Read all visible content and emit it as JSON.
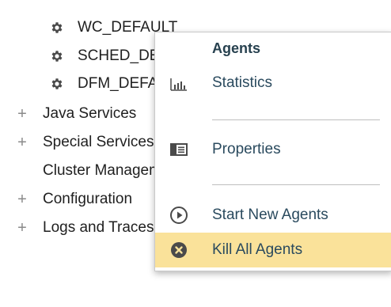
{
  "tree": {
    "children": [
      {
        "label": "WC_DEFAULT",
        "icon": "gear-icon"
      },
      {
        "label": "SCHED_DEFAULT",
        "icon": "gear-icon"
      },
      {
        "label": "DFM_DEFAULT",
        "icon": "gear-icon"
      }
    ],
    "roots": [
      {
        "label": "Java Services",
        "expander": "+"
      },
      {
        "label": "Special Services",
        "expander": "+"
      },
      {
        "label": "Cluster Management",
        "expander": ""
      },
      {
        "label": "Configuration",
        "expander": "+"
      },
      {
        "label": "Logs and Traces",
        "expander": "+"
      }
    ]
  },
  "context_menu": {
    "heading": "Agents",
    "items": [
      {
        "label": "Statistics",
        "icon": "statistics-chart-icon"
      },
      {
        "label": "Properties",
        "icon": "properties-icon"
      },
      {
        "label": "Start New Agents",
        "icon": "play-circle-icon"
      },
      {
        "label": "Kill All Agents",
        "icon": "close-circle-icon",
        "highlighted": true
      }
    ]
  },
  "colors": {
    "highlight": "#fae29a",
    "menu_text": "#2a4a5e",
    "icon_dark": "#4a4a4a"
  }
}
